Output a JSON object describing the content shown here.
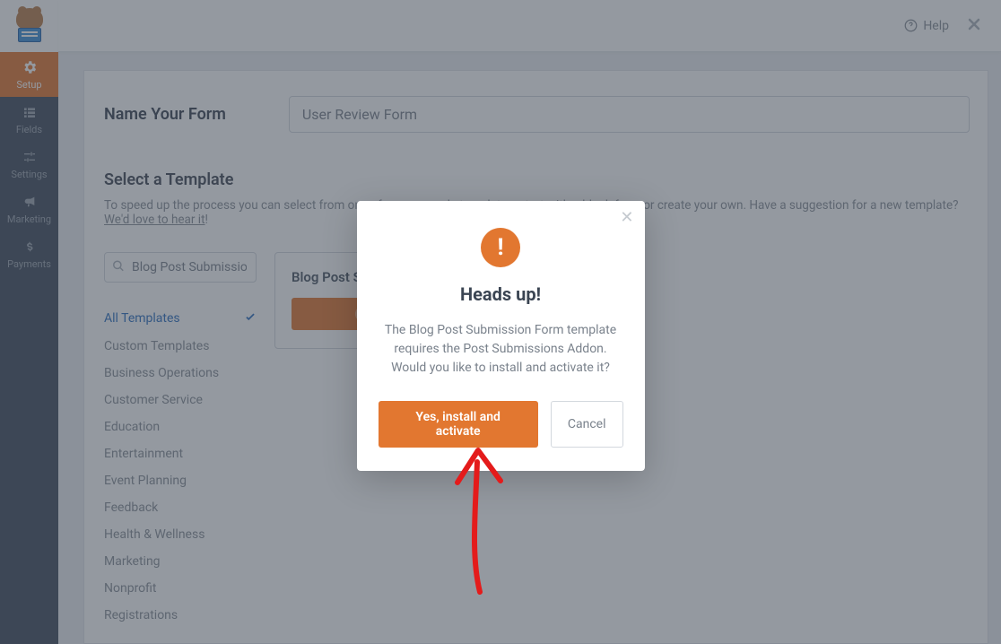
{
  "nav": {
    "items": [
      {
        "label": "Setup"
      },
      {
        "label": "Fields"
      },
      {
        "label": "Settings"
      },
      {
        "label": "Marketing"
      },
      {
        "label": "Payments"
      }
    ]
  },
  "topbar": {
    "help": "Help"
  },
  "form": {
    "name_label": "Name Your Form",
    "name_value": "User Review Form"
  },
  "templates": {
    "heading": "Select a Template",
    "subtext_pre": "To speed up the process you can select from one of our pre-made templates, start with a blank form or create your own. Have a suggestion for a new template? ",
    "subtext_link": "We'd love to hear it",
    "subtext_post": "!",
    "search_value": "Blog Post Submission",
    "categories": [
      "All Templates",
      "Custom Templates",
      "Business Operations",
      "Customer Service",
      "Education",
      "Entertainment",
      "Event Planning",
      "Feedback",
      "Health & Wellness",
      "Marketing",
      "Nonprofit",
      "Registrations"
    ],
    "card_title": "Blog Post Submission Form"
  },
  "modal": {
    "title": "Heads up!",
    "text": "The Blog Post Submission Form template requires the Post Submissions Addon. Would you like to install and activate it?",
    "primary": "Yes, install and activate",
    "secondary": "Cancel"
  }
}
